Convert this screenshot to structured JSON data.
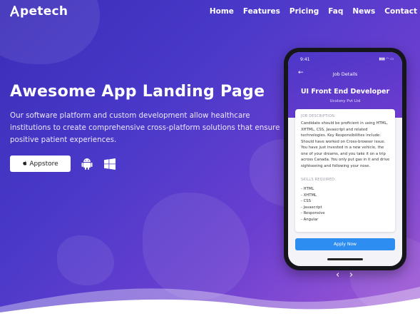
{
  "brand": {
    "name": "petech"
  },
  "nav": {
    "items": [
      "Home",
      "Features",
      "Pricing",
      "Faq",
      "News",
      "Contact"
    ]
  },
  "hero": {
    "headline": "Awesome App Landing Page",
    "description": "Our software platform and custom development allow healthcare institutions to create comprehensive cross-platform solutions that ensure positive patient experiences.",
    "appstore_label": "Appstore"
  },
  "phone": {
    "time": "9:41",
    "screen_title": "Job Details",
    "job_title": "UI Front End Developer",
    "company": "Ucolony Pvt Ltd",
    "job_description_heading": "JOB DESCRIPTION:",
    "job_description": "Candidate should be proficient in using HTML, XHTML, CSS, Javascript and related technologies. Key Responsibilities include: Should have worked on Cross-browser issue. You have just invested in a new vehicle, the one of your dreams, and you take it on a trip across Canada. You only put gas in it and drive sightseeing and following your nose.",
    "skills_heading": "SKILLS REQUIRED:",
    "skills": [
      "- HTML",
      "- XHTML",
      "- CSS",
      "- Javascript",
      "- Responsive",
      "- Angular"
    ],
    "apply_label": "Apply Now"
  },
  "slider": {
    "prev": "‹",
    "next": "›"
  },
  "colors": {
    "gradient_start": "#3b2db8",
    "gradient_end": "#a45ad6",
    "apply_button": "#2e8df0"
  }
}
